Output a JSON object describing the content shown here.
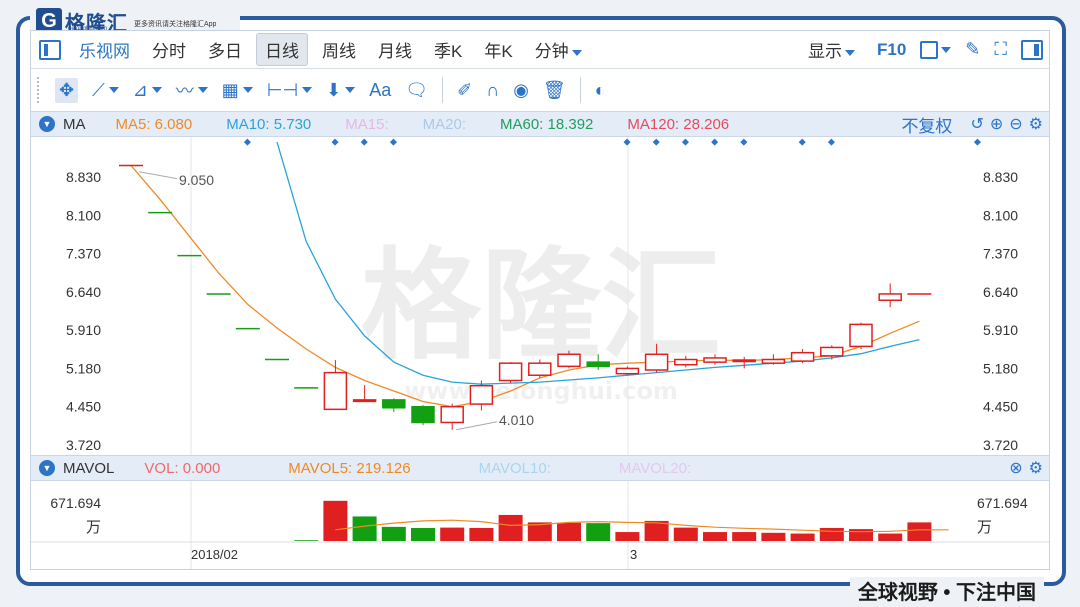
{
  "brand": {
    "logo_text": "格隆汇",
    "logo_sub": "gelonghui.com",
    "slogan": "更多资讯请关注格隆汇App",
    "bottom_slogan": "全球视野 • 下注中国",
    "watermark": "格隆汇",
    "watermark_sub": "www.gelonghui.com"
  },
  "topnav": {
    "items": [
      {
        "label": "乐视网",
        "active": false,
        "brand": true
      },
      {
        "label": "分时",
        "active": false
      },
      {
        "label": "多日",
        "active": false
      },
      {
        "label": "日线",
        "active": true
      },
      {
        "label": "周线",
        "active": false
      },
      {
        "label": "月线",
        "active": false
      },
      {
        "label": "季K",
        "active": false
      },
      {
        "label": "年K",
        "active": false
      },
      {
        "label": "分钟",
        "active": false,
        "dropdown": true
      }
    ],
    "display_label": "显示",
    "f10_label": "F10"
  },
  "toolbar": {
    "font_label": "Aa"
  },
  "ma_bar": {
    "title": "MA",
    "items": [
      {
        "label": "MA5: 6.080",
        "color": "#f08a24"
      },
      {
        "label": "MA10: 5.730",
        "color": "#2aa3d9"
      },
      {
        "label": "MA15:",
        "color": "#e4b8e4"
      },
      {
        "label": "MA20:",
        "color": "#a9c8ee"
      },
      {
        "label": "MA60: 18.392",
        "color": "#1f9e5c"
      },
      {
        "label": "MA120: 28.206",
        "color": "#e84a5f"
      }
    ],
    "adjust_label": "不复权"
  },
  "vol_bar": {
    "title": "MAVOL",
    "items": [
      {
        "label": "VOL: 0.000",
        "color": "#f06a6a"
      },
      {
        "label": "MAVOL5: 219.126",
        "color": "#f08a24"
      },
      {
        "label": "MAVOL10:",
        "color": "#a9d6ee"
      },
      {
        "label": "MAVOL20:",
        "color": "#e4c8ee"
      }
    ]
  },
  "colors": {
    "up": "#e02020",
    "down": "#12a012",
    "ma5": "#f08a24",
    "ma10": "#2aa3d9",
    "accent": "#2b74c7"
  },
  "chart_data": {
    "type": "candlestick",
    "y_ticks": [
      "8.830",
      "8.100",
      "7.370",
      "6.640",
      "5.910",
      "5.180",
      "4.450",
      "3.720"
    ],
    "ylim": [
      3.72,
      8.83
    ],
    "x_labels": [
      "2018/02",
      "3"
    ],
    "annotations": [
      {
        "text": "9.050",
        "value": 9.05
      },
      {
        "text": "4.010",
        "value": 4.01
      }
    ],
    "candles": [
      {
        "o": 9.05,
        "c": 9.05,
        "h": 9.05,
        "l": 9.05
      },
      {
        "o": 8.15,
        "c": 8.15,
        "h": 8.15,
        "l": 8.15
      },
      {
        "o": 7.33,
        "c": 7.33,
        "h": 7.33,
        "l": 7.33
      },
      {
        "o": 6.6,
        "c": 6.6,
        "h": 6.6,
        "l": 6.6
      },
      {
        "o": 5.94,
        "c": 5.94,
        "h": 5.94,
        "l": 5.94
      },
      {
        "o": 5.35,
        "c": 5.35,
        "h": 5.35,
        "l": 5.35
      },
      {
        "o": 4.81,
        "c": 4.81,
        "h": 4.81,
        "l": 4.81
      },
      {
        "o": 4.4,
        "c": 5.1,
        "h": 5.34,
        "l": 4.4
      },
      {
        "o": 4.58,
        "c": 4.58,
        "h": 4.86,
        "l": 4.58
      },
      {
        "o": 4.58,
        "c": 4.43,
        "h": 4.61,
        "l": 4.35
      },
      {
        "o": 4.45,
        "c": 4.15,
        "h": 4.48,
        "l": 4.1
      },
      {
        "o": 4.15,
        "c": 4.45,
        "h": 4.51,
        "l": 4.01
      },
      {
        "o": 4.5,
        "c": 4.85,
        "h": 4.95,
        "l": 4.38
      },
      {
        "o": 4.95,
        "c": 5.28,
        "h": 5.3,
        "l": 4.9
      },
      {
        "o": 5.05,
        "c": 5.28,
        "h": 5.35,
        "l": 5.0
      },
      {
        "o": 5.22,
        "c": 5.45,
        "h": 5.52,
        "l": 5.18
      },
      {
        "o": 5.3,
        "c": 5.22,
        "h": 5.45,
        "l": 5.15
      },
      {
        "o": 5.08,
        "c": 5.18,
        "h": 5.22,
        "l": 5.05
      },
      {
        "o": 5.15,
        "c": 5.45,
        "h": 5.65,
        "l": 5.1
      },
      {
        "o": 5.25,
        "c": 5.35,
        "h": 5.42,
        "l": 5.2
      },
      {
        "o": 5.3,
        "c": 5.38,
        "h": 5.45,
        "l": 5.25
      },
      {
        "o": 5.32,
        "c": 5.34,
        "h": 5.4,
        "l": 5.18
      },
      {
        "o": 5.28,
        "c": 5.35,
        "h": 5.45,
        "l": 5.25
      },
      {
        "o": 5.32,
        "c": 5.48,
        "h": 5.55,
        "l": 5.28
      },
      {
        "o": 5.42,
        "c": 5.58,
        "h": 5.62,
        "l": 5.35
      },
      {
        "o": 5.6,
        "c": 6.02,
        "h": 6.05,
        "l": 5.55
      },
      {
        "o": 6.48,
        "c": 6.6,
        "h": 6.8,
        "l": 6.35
      },
      {
        "o": 6.6,
        "c": 6.6,
        "h": 6.6,
        "l": 6.6
      }
    ],
    "ma5": [
      9.05,
      8.4,
      7.7,
      7.0,
      6.4,
      5.95,
      5.55,
      5.2,
      4.95,
      4.75,
      4.55,
      4.45,
      4.55,
      4.75,
      5.0,
      5.15,
      5.25,
      5.28,
      5.3,
      5.32,
      5.34,
      5.33,
      5.35,
      5.38,
      5.42,
      5.6,
      5.85,
      6.08
    ],
    "ma10": [
      null,
      null,
      null,
      null,
      null,
      9.5,
      7.6,
      6.5,
      5.8,
      5.3,
      5.05,
      4.92,
      4.88,
      4.9,
      4.92,
      4.96,
      5.0,
      5.05,
      5.1,
      5.15,
      5.2,
      5.24,
      5.28,
      5.32,
      5.38,
      5.46,
      5.6,
      5.73
    ],
    "markers": [
      1,
      4,
      5,
      6,
      14,
      15,
      16,
      17,
      18,
      20,
      21,
      26
    ],
    "volume": {
      "label": "671.694",
      "unit": "万",
      "ylim": [
        0,
        671.694
      ],
      "bars": [
        0,
        0,
        0,
        0,
        0,
        0,
        10,
        540,
        330,
        190,
        175,
        180,
        175,
        350,
        250,
        245,
        240,
        120,
        270,
        180,
        120,
        120,
        110,
        100,
        175,
        160,
        100,
        250,
        0
      ],
      "up": [
        true,
        true,
        true,
        true,
        true,
        true,
        false,
        true,
        false,
        false,
        false,
        true,
        true,
        true,
        true,
        true,
        false,
        true,
        true,
        true,
        true,
        true,
        true,
        true,
        true,
        true,
        true,
        true,
        true
      ],
      "mavol5": [
        null,
        null,
        null,
        null,
        null,
        null,
        null,
        150,
        200,
        240,
        270,
        280,
        260,
        210,
        220,
        250,
        260,
        250,
        245,
        210,
        185,
        170,
        160,
        145,
        130,
        125,
        130,
        150,
        150
      ]
    }
  }
}
